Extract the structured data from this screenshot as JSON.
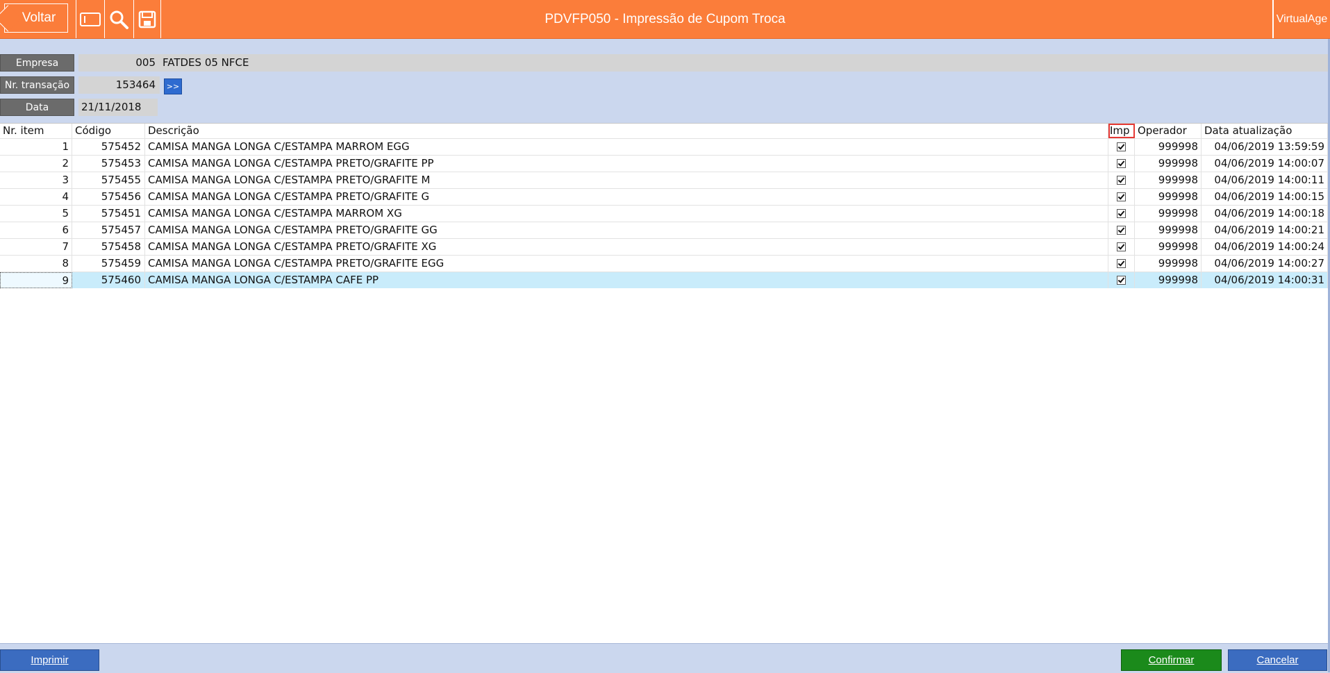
{
  "header": {
    "back_label": "Voltar",
    "title": "PDVFP050 - Impressão de Cupom Troca",
    "brand": "VirtualAge",
    "tools": [
      "window-icon",
      "search-icon",
      "save-icon"
    ]
  },
  "form": {
    "empresa_label": "Empresa",
    "empresa_code": "005",
    "empresa_name": "FATDES 05 NFCE",
    "transacao_label": "Nr. transação",
    "transacao_value": "153464",
    "go_label": ">>",
    "data_label": "Data",
    "data_value": "21/11/2018"
  },
  "grid": {
    "columns": [
      "Nr. item",
      "Código",
      "Descrição",
      "Imp",
      "Operador",
      "Data atualização"
    ],
    "rows": [
      {
        "item": "1",
        "codigo": "575452",
        "descricao": "CAMISA MANGA LONGA C/ESTAMPA MARROM EGG",
        "imp": true,
        "operador": "999998",
        "data": "04/06/2019 13:59:59"
      },
      {
        "item": "2",
        "codigo": "575453",
        "descricao": "CAMISA MANGA LONGA C/ESTAMPA PRETO/GRAFITE PP",
        "imp": true,
        "operador": "999998",
        "data": "04/06/2019 14:00:07"
      },
      {
        "item": "3",
        "codigo": "575455",
        "descricao": "CAMISA MANGA LONGA C/ESTAMPA PRETO/GRAFITE M",
        "imp": true,
        "operador": "999998",
        "data": "04/06/2019 14:00:11"
      },
      {
        "item": "4",
        "codigo": "575456",
        "descricao": "CAMISA MANGA LONGA C/ESTAMPA PRETO/GRAFITE G",
        "imp": true,
        "operador": "999998",
        "data": "04/06/2019 14:00:15"
      },
      {
        "item": "5",
        "codigo": "575451",
        "descricao": "CAMISA MANGA LONGA C/ESTAMPA MARROM XG",
        "imp": true,
        "operador": "999998",
        "data": "04/06/2019 14:00:18"
      },
      {
        "item": "6",
        "codigo": "575457",
        "descricao": "CAMISA MANGA LONGA C/ESTAMPA PRETO/GRAFITE GG",
        "imp": true,
        "operador": "999998",
        "data": "04/06/2019 14:00:21"
      },
      {
        "item": "7",
        "codigo": "575458",
        "descricao": "CAMISA MANGA LONGA C/ESTAMPA PRETO/GRAFITE XG",
        "imp": true,
        "operador": "999998",
        "data": "04/06/2019 14:00:24"
      },
      {
        "item": "8",
        "codigo": "575459",
        "descricao": "CAMISA MANGA LONGA C/ESTAMPA PRETO/GRAFITE EGG",
        "imp": true,
        "operador": "999998",
        "data": "04/06/2019 14:00:27"
      },
      {
        "item": "9",
        "codigo": "575460",
        "descricao": "CAMISA MANGA LONGA C/ESTAMPA CAFE PP",
        "imp": true,
        "operador": "999998",
        "data": "04/06/2019 14:00:31",
        "selected": true
      }
    ]
  },
  "footer": {
    "print_label": "Imprimir",
    "confirm_label": "Confirmar",
    "cancel_label": "Cancelar"
  },
  "colors": {
    "header": "#fb7d3a",
    "panel": "#cbd7ee",
    "confirm": "#1b8a1b",
    "button_blue": "#3b6cc0",
    "selected_row": "#c9ecfb"
  }
}
